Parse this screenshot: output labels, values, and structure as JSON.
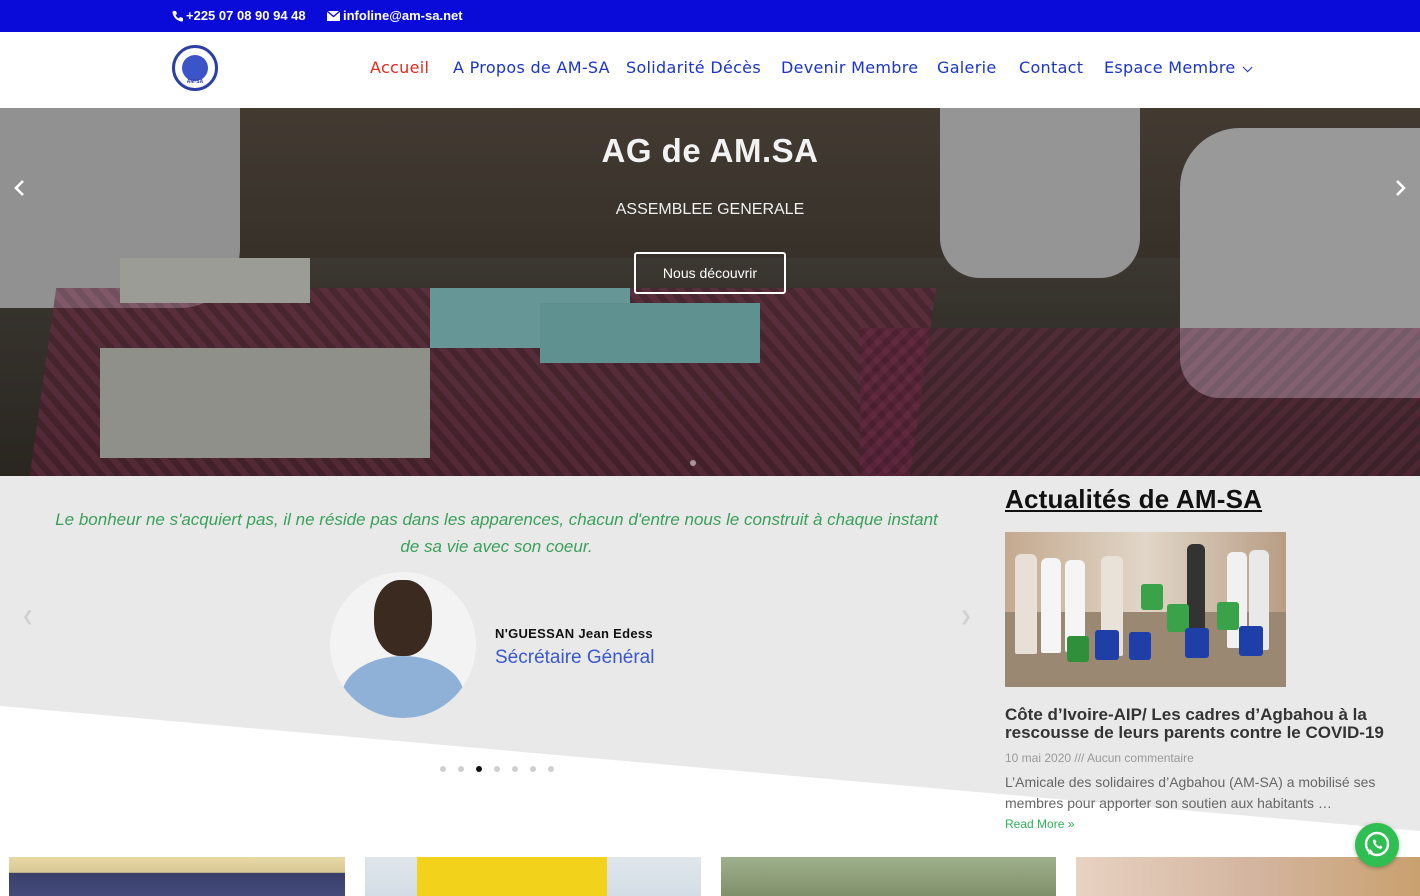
{
  "topbar": {
    "phone": "+225 07 08 90 94 48",
    "email": "infoline@am-sa.net"
  },
  "header": {
    "logo_text": "AM·SA",
    "nav": [
      {
        "label": "Accueil",
        "active": true
      },
      {
        "label": "A Propos de AM-SA"
      },
      {
        "label": "Solidarité Décès"
      },
      {
        "label": "Devenir Membre"
      },
      {
        "label": "Galerie"
      },
      {
        "label": "Contact"
      },
      {
        "label": "Espace Membre",
        "dropdown": true
      }
    ]
  },
  "hero": {
    "title": "AG de AM.SA",
    "subtitle": "ASSEMBLEE GENERALE",
    "button": "Nous découvrir"
  },
  "testimonial": {
    "quote": "Le bonheur ne s'acquiert pas, il ne réside pas dans les apparences, chacun d'entre nous le construit à chaque instant de sa vie avec son coeur.",
    "name": "N'GUESSAN Jean Edess",
    "role": "Sécrétaire Général",
    "dot_count": 7,
    "active_dot": 3
  },
  "news": {
    "heading": "Actualités de AM-SA",
    "post": {
      "title": "Côte d’Ivoire-AIP/ Les cadres d’Agbahou à la rescousse de leurs parents contre le COVID-19",
      "meta": "10 mai 2020 /// Aucun commentaire",
      "excerpt": "L’Amicale des solidaires d’Agbahou (AM-SA) a mobilisé ses membres pour apporter son soutien aux habitants …",
      "read_more": "Read More »"
    }
  },
  "colors": {
    "topbar": "#0a0ad9",
    "nav_link": "#1b35c4",
    "nav_active": "#e5281c",
    "quote": "#3aa05a",
    "role": "#3b57cf",
    "read_more": "#2db15a",
    "whatsapp": "#2fbe51"
  },
  "icons": {
    "phone": "phone-icon",
    "email": "envelope-icon",
    "whatsapp": "whatsapp-icon"
  }
}
